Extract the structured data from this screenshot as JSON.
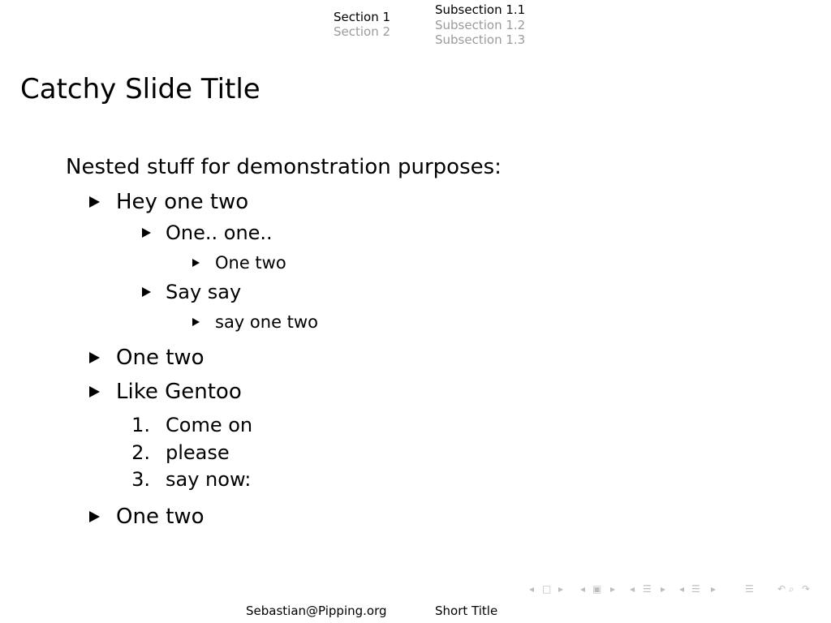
{
  "nav": {
    "sections": [
      {
        "label": "Section 1",
        "active": true
      },
      {
        "label": "Section 2",
        "active": false
      }
    ],
    "subsections": [
      {
        "label": "Subsection 1.1",
        "active": true
      },
      {
        "label": "Subsection 1.2",
        "active": false
      },
      {
        "label": "Subsection 1.3",
        "active": false
      }
    ]
  },
  "frame": {
    "title": "Catchy Slide Title",
    "intro": "Nested stuff for demonstration purposes:",
    "items": [
      {
        "label": "Hey one two"
      },
      {
        "label": "One.. one.."
      },
      {
        "label": "One two"
      },
      {
        "label": "Say say"
      },
      {
        "label": "say one two"
      },
      {
        "label": "One two"
      },
      {
        "label": "Like Gentoo"
      },
      {
        "number": "1.",
        "label": "Come on"
      },
      {
        "number": "2.",
        "label": "please"
      },
      {
        "number": "3.",
        "label": "say now:"
      },
      {
        "label": "One two"
      }
    ]
  },
  "navigation_symbols": {
    "color": "#bdbdbd",
    "icons": [
      "nav-left-arrow",
      "slide-icon",
      "nav-right-arrow",
      "frame-icon",
      "subsection-icon",
      "section-icon",
      "align-icon",
      "search-icon",
      "back-forward-icon"
    ]
  },
  "footer": {
    "author": "Sebastian@Pipping.org",
    "short_title": "Short Title"
  },
  "colors": {
    "active": "#000000",
    "inactive": "#9b9b9b"
  }
}
